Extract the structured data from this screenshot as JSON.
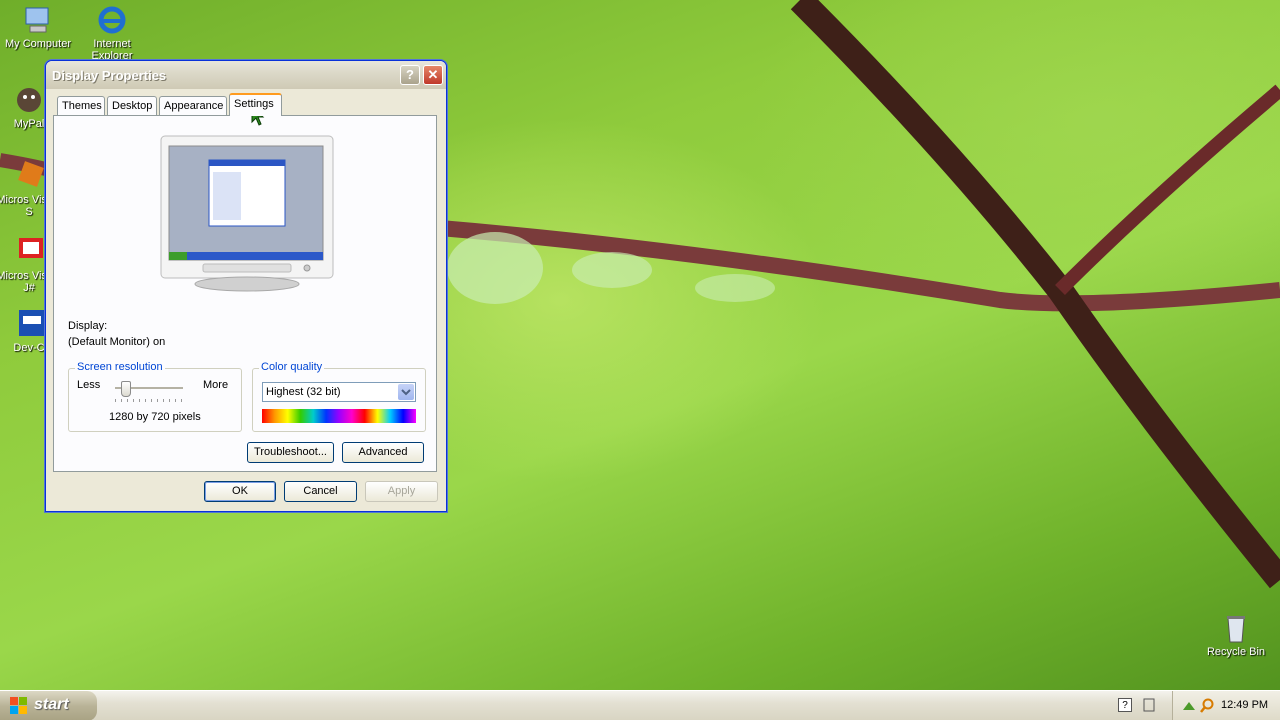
{
  "desktop": {
    "icons": [
      {
        "label": "My Computer",
        "icon": "my-computer-icon"
      },
      {
        "label": "Internet Explorer",
        "icon": "internet-explorer-icon"
      },
      {
        "label": "MyPal",
        "icon": "mypal-icon"
      },
      {
        "label": "Micros Visual S",
        "icon": "visual-studio-icon"
      },
      {
        "label": "Micros Visual J#",
        "icon": "visual-jsharp-icon"
      },
      {
        "label": "Dev-C",
        "icon": "dev-cpp-icon"
      },
      {
        "label": "Recycle Bin",
        "icon": "recycle-bin-icon"
      }
    ]
  },
  "dialog": {
    "title": "Display Properties",
    "help_glyph": "?",
    "close_glyph": "✕",
    "tabs": [
      {
        "label": "Themes"
      },
      {
        "label": "Desktop"
      },
      {
        "label": "Appearance"
      },
      {
        "label": "Settings",
        "active": true
      }
    ],
    "display_label": "Display:",
    "display_value": "(Default Monitor) on",
    "resolution": {
      "legend": "Screen resolution",
      "less": "Less",
      "more": "More",
      "value_text": "1280 by 720 pixels",
      "slider_level": 0.1
    },
    "color": {
      "legend": "Color quality",
      "selected": "Highest (32 bit)"
    },
    "buttons": {
      "troubleshoot": "Troubleshoot...",
      "advanced": "Advanced",
      "ok": "OK",
      "cancel": "Cancel",
      "apply": "Apply"
    }
  },
  "taskbar": {
    "start_label": "start",
    "clock": "12:49 PM"
  },
  "colors": {
    "accent_orange": "#ff9b1f",
    "legend_blue": "#0046d5",
    "desktop_green": "#8fcb3c"
  }
}
